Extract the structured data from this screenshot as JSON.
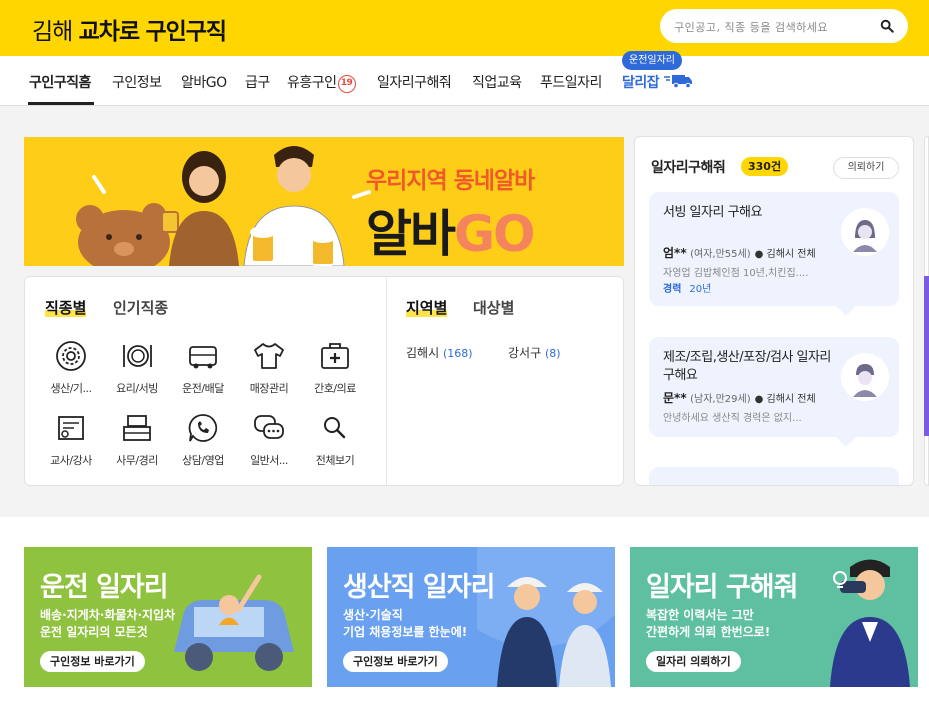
{
  "header": {
    "logo_region": "김해",
    "logo_brand": "교차로",
    "logo_section": "구인구직",
    "search_placeholder": "구인공고, 직종 등을 검색하세요"
  },
  "nav": {
    "items": [
      "구인구직홈",
      "구인정보",
      "알바GO",
      "급구",
      "유흥구인",
      "일자리구해줘",
      "직업교육",
      "푸드일자리",
      "달리잡"
    ],
    "adult_badge": "19",
    "driver_pill": "운전일자리"
  },
  "banner": {
    "subtitle": "우리지역 동네알바",
    "title_a": "알바",
    "title_b": "GO"
  },
  "categories": {
    "tabs": [
      "직종별",
      "인기직종"
    ],
    "items": [
      "생산/기...",
      "요리/서빙",
      "운전/배달",
      "매장관리",
      "간호/의료",
      "교사/강사",
      "사무/경리",
      "상담/영업",
      "일반서...",
      "전체보기"
    ],
    "region_tabs": [
      "지역별",
      "대상별"
    ],
    "regions": [
      {
        "name": "김해시",
        "count": "(168)"
      },
      {
        "name": "강서구",
        "count": "(8)"
      }
    ]
  },
  "jobseek": {
    "title": "일자리구해줘",
    "count": "330건",
    "request_button": "의뢰하기",
    "cards": [
      {
        "title": "서빙 일자리 구해요",
        "name": "엄**",
        "meta": "(여자,만55세)",
        "location": "김해시 전체",
        "desc": "자영업 김밥체인점 10년,치킨집....",
        "exp_label": "경력",
        "exp_value": "20년"
      },
      {
        "title": "제조/조립,생산/포장/검사 일자리 구해요",
        "name": "문**",
        "meta": "(남자,만29세)",
        "location": "김해시 전체",
        "desc": "안녕하세요 생산직 경력은 없지...",
        "exp_label": "",
        "exp_value": ""
      }
    ]
  },
  "promos": [
    {
      "title": "운전 일자리",
      "desc1": "배송·지게차·화물차·지입차",
      "desc2": "운전 일자리의 모든것",
      "button": "구인정보 바로가기",
      "color": "#8fc23f"
    },
    {
      "title": "생산직 일자리",
      "desc1": "생산·기술직",
      "desc2": "기업 채용정보를 한눈에!",
      "button": "구인정보 바로가기",
      "color": "#6aa0f0"
    },
    {
      "title": "일자리 구해줘",
      "desc1": "복잡한 이력서는 그만",
      "desc2": "간편하게 의뢰 한번으로!",
      "button": "일자리 의뢰하기",
      "color": "#5ec0a0"
    }
  ],
  "colors": {
    "brand_yellow": "#ffd600",
    "accent_blue": "#2f6bd8",
    "badge_red": "#e34b3f"
  }
}
